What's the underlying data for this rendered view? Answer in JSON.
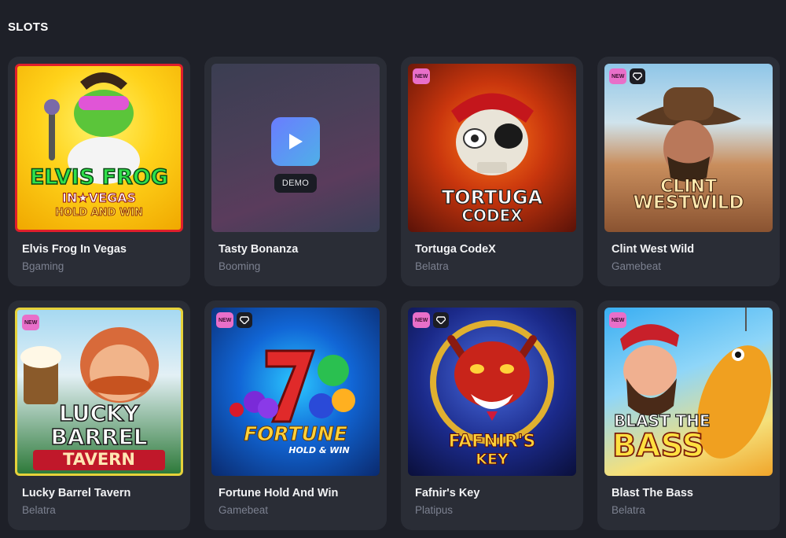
{
  "section": {
    "title": "SLOTS"
  },
  "games": [
    {
      "title": "Elvis Frog In Vegas",
      "provider": "Bgaming",
      "art_text": [
        "ELVIS FROG",
        "IN★VEGAS",
        "HOLD AND WIN"
      ],
      "badges": []
    },
    {
      "title": "Tasty Bonanza",
      "provider": "Booming",
      "art_text": [],
      "badges": [],
      "demo_label": "DEMO"
    },
    {
      "title": "Tortuga CodeX",
      "provider": "Belatra",
      "art_text": [
        "TORTUGA",
        "CODEX"
      ],
      "badges": [
        "NEW"
      ]
    },
    {
      "title": "Clint West Wild",
      "provider": "Gamebeat",
      "art_text": [
        "CLINT",
        "WESTWILD"
      ],
      "badges": [
        "NEW",
        "gem"
      ]
    },
    {
      "title": "Lucky Barrel Tavern",
      "provider": "Belatra",
      "art_text": [
        "LUCKY",
        "BARREL",
        "TAVERN"
      ],
      "badges": [
        "NEW"
      ]
    },
    {
      "title": "Fortune Hold And Win",
      "provider": "Gamebeat",
      "art_text": [
        "FORTUNE",
        "HOLD & WIN"
      ],
      "badges": [
        "NEW",
        "gem"
      ]
    },
    {
      "title": "Fafnir's Key",
      "provider": "Platipus",
      "art_text": [
        "FAFNIR'S",
        "KEY"
      ],
      "badges": [
        "NEW",
        "gem"
      ]
    },
    {
      "title": "Blast The Bass",
      "provider": "Belatra",
      "art_text": [
        "BLAST THE",
        "BASS"
      ],
      "badges": [
        "NEW"
      ]
    }
  ],
  "badge_labels": {
    "new": "NEW"
  },
  "colors": {
    "background": "#1e2028",
    "card": "#2a2d36",
    "new_badge": "#e86fc9",
    "provider_text": "#7c8190"
  }
}
